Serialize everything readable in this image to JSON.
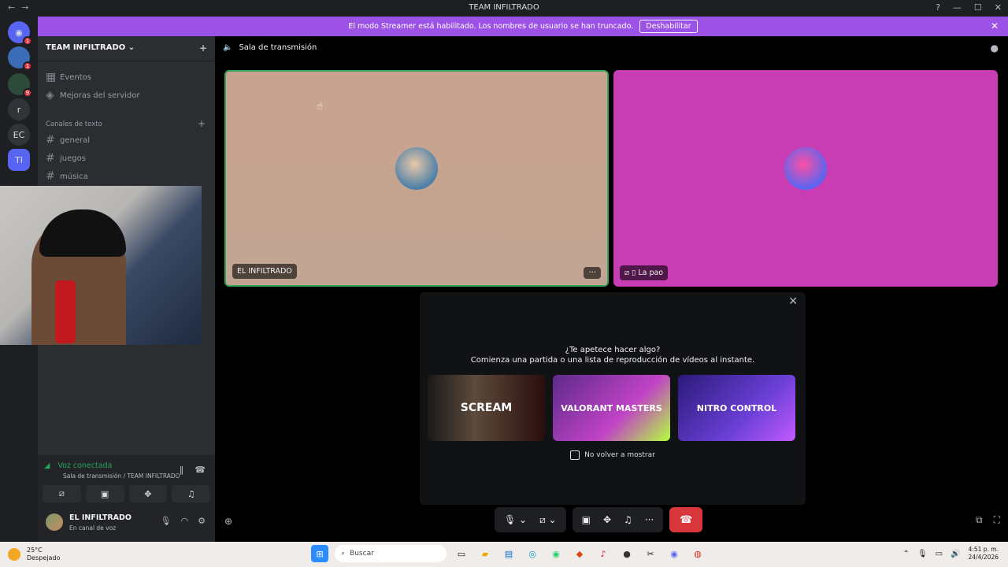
{
  "window": {
    "title": "TEAM INFILTRADO"
  },
  "banner": {
    "text": "El modo Streamer está habilitado. Los nombres de usuario se han truncado.",
    "button": "Deshabilitar"
  },
  "servers": [
    {
      "label": "",
      "badge": "1"
    },
    {
      "label": "",
      "badge": "1"
    },
    {
      "label": "",
      "badge": "9"
    },
    {
      "label": "r",
      "badge": ""
    },
    {
      "label": "EC",
      "badge": ""
    },
    {
      "label": "TI",
      "badge": ""
    }
  ],
  "sidebar": {
    "server_name": "TEAM INFILTRADO",
    "items": [
      {
        "label": "Eventos"
      },
      {
        "label": "Mejoras del servidor"
      }
    ],
    "category": "Canales de texto",
    "channels": [
      {
        "label": "general"
      },
      {
        "label": "juegos"
      },
      {
        "label": "música"
      }
    ]
  },
  "voice": {
    "status": "Voz conectada",
    "location": "Sala de transmisión / TEAM INFILTRADO",
    "user_name": "EL INFILTRADO",
    "user_status": "En canal de voz"
  },
  "stage": {
    "channel_name": "Sala de transmisión",
    "tiles": [
      {
        "label": "EL INFILTRADO"
      },
      {
        "label": "La pao"
      }
    ]
  },
  "activity": {
    "title": "¿Te apetece hacer algo?",
    "subtitle": "Comienza una partida o una lista de reproducción de vídeos al instante.",
    "cards": [
      {
        "label": "SCREAM"
      },
      {
        "label": "VALORANT MASTERS"
      },
      {
        "label": "NITRO CONTROL"
      }
    ],
    "dont_show": "No volver a mostrar"
  },
  "taskbar": {
    "weather_temp": "25°C",
    "weather_desc": "Despejado",
    "search_placeholder": "Buscar",
    "time": "4:51 p. m.",
    "date": "24/4/2026"
  }
}
